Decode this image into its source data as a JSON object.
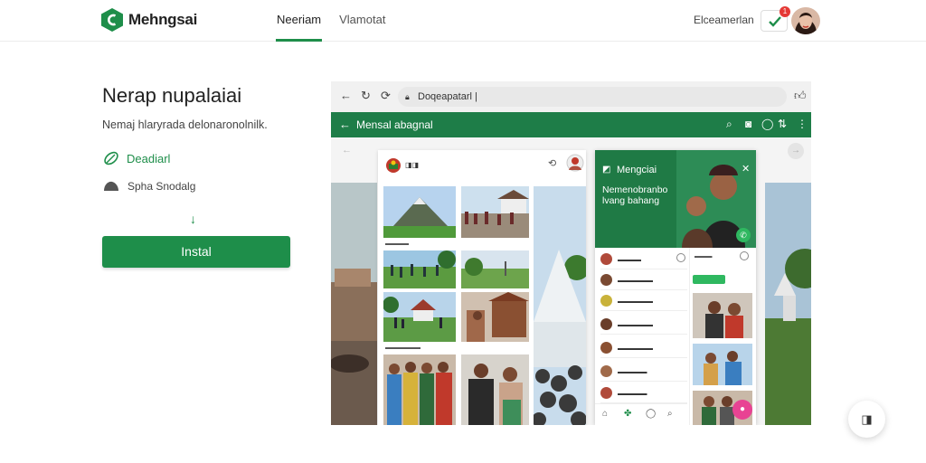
{
  "header": {
    "app_name": "Mehngsai",
    "tabs": [
      {
        "label": "Neeriam",
        "active": true
      },
      {
        "label": "Vlamotat",
        "active": false
      }
    ],
    "right_link": "Elceamerlan",
    "notification_count": "1"
  },
  "hero": {
    "title": "Nerap nupalaiai",
    "subtitle": "Nemaj hlaryrada delonaronolnilk.",
    "feature_1": "Deadiarl",
    "feature_2": "Spha Snodalg",
    "install_label": "Instal"
  },
  "browser": {
    "url": "Doqeapatarl"
  },
  "app": {
    "header_title": "Mensal abagnal",
    "chat_title": "Mengciai",
    "chat_banner": "Nemenobranbo lvang bahang"
  },
  "colors": {
    "accent": "#1e8e4a",
    "app_header": "#1e7d48"
  },
  "icons": {
    "logo": "brand-logo-icon",
    "feature_1": "leaf-icon",
    "feature_2": "cloud-icon",
    "fab": "square-icon"
  }
}
